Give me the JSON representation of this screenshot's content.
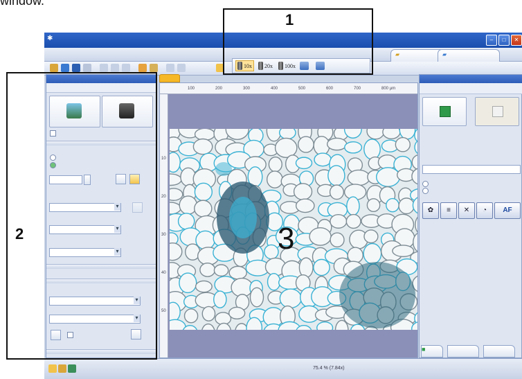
{
  "caption": {
    "text": "window."
  },
  "objective_toolbar": {
    "items": [
      {
        "label": "10x",
        "active": true
      },
      {
        "label": "20x",
        "active": false
      },
      {
        "label": "100x",
        "active": false
      }
    ]
  },
  "callouts": {
    "one": "1",
    "two": "2",
    "three": "3"
  },
  "ruler": {
    "ticks": [
      "100",
      "200",
      "300",
      "400",
      "500",
      "600",
      "700",
      "800 µm"
    ],
    "v_ticks": [
      "10",
      "20",
      "30",
      "40",
      "50"
    ]
  },
  "status": {
    "zoom": "75.4 % (7.84x)"
  },
  "right_panel": {
    "af_label": "AF"
  },
  "colors": {
    "title_blue": "#2d5cb8",
    "active_tab": "#f6b826",
    "cell_cyan": "#3ab2d4",
    "doc_background": "#8b90b8"
  },
  "icons": {
    "left_big_buttons": [
      "acquire-icon",
      "camera-icon"
    ],
    "right_big_buttons": [
      "start-icon",
      "stop-icon"
    ],
    "right_tools": [
      "color-wheel-icon",
      "layers-icon",
      "crosshair-icon",
      "stopwatch-icon"
    ]
  }
}
